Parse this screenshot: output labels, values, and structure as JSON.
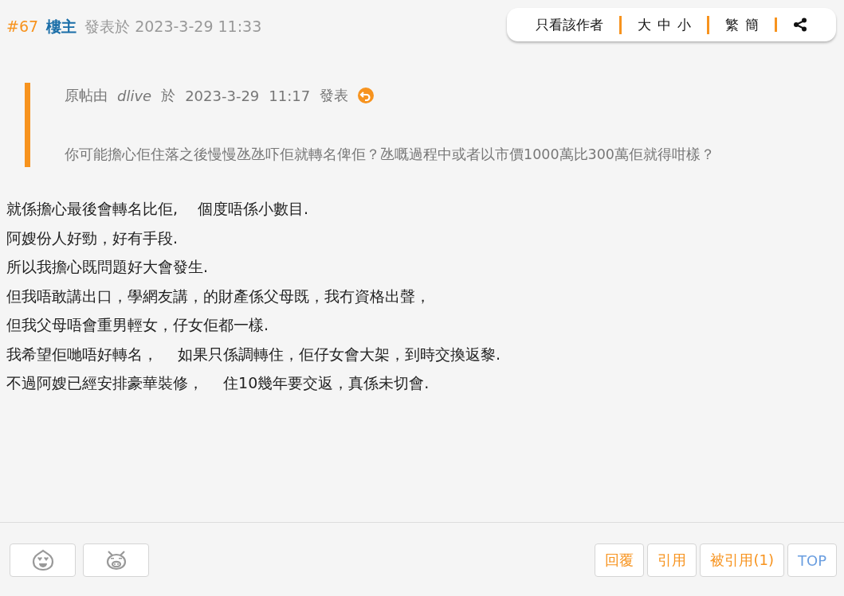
{
  "post": {
    "floor": "#67",
    "author": "樓主",
    "posted_label": "發表於",
    "posted_at": "2023-3-29 11:33"
  },
  "toolbar": [
    {
      "kind": "text",
      "label": "只看該作者"
    },
    {
      "kind": "group",
      "labels": [
        "大",
        "中",
        "小"
      ]
    },
    {
      "kind": "group",
      "labels": [
        "繁",
        "簡"
      ]
    },
    {
      "kind": "share"
    }
  ],
  "quote": {
    "prefix": "原帖由",
    "author": "dlive",
    "on": "於",
    "date": "2023-3-29",
    "time": "11:17",
    "suffix": "發表",
    "text": "你可能擔心佢住落之後慢慢氹氹吓佢就轉名俾佢？氹嘅過程中或者以市價1000萬比300萬佢就得咁樣？"
  },
  "body": [
    "就係擔心最後會轉名比佢,　 個度唔係小數目.",
    "阿嫂份人好勁，好有手段.",
    "所以我擔心既問題好大會發生.",
    "但我唔敢講出口，學網友講，的財產係父母既，我冇資格出聲，",
    "但我父母唔會重男輕女，仔女佢都一樣.",
    "我希望佢哋唔好轉名，　 如果只係調轉住，佢仔女會大架，到時交換返黎.",
    "不過阿嫂已經安排豪華裝修，　 住10幾年要交返，真係未切會."
  ],
  "reactions": [
    {
      "kind": "love"
    },
    {
      "kind": "pig"
    }
  ],
  "actions": [
    {
      "kind": "action",
      "label": "回覆"
    },
    {
      "kind": "action",
      "label": "引用"
    },
    {
      "kind": "action",
      "label": "被引用(1)"
    },
    {
      "kind": "top",
      "label": "TOP"
    }
  ]
}
